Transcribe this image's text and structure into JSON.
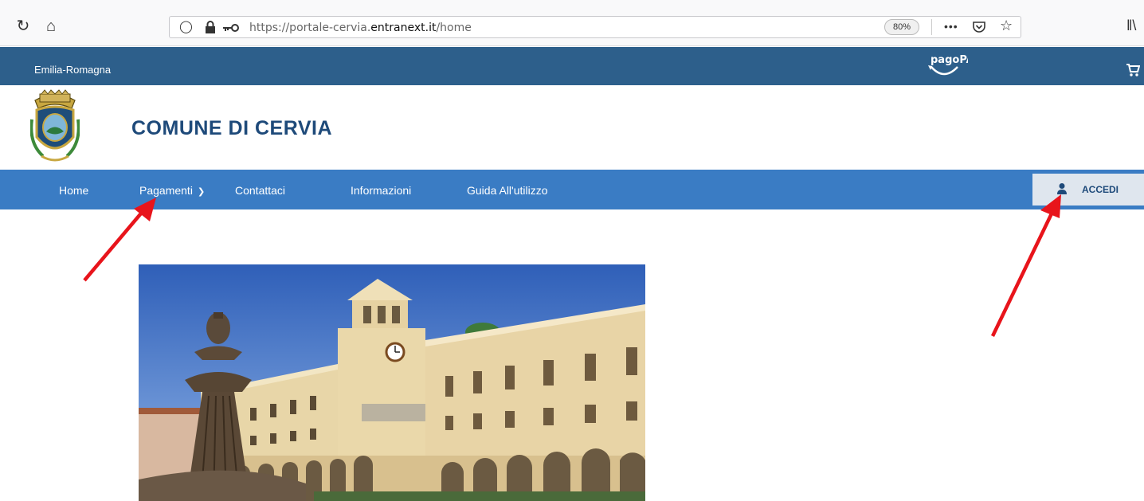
{
  "browser": {
    "url_prefix": "https://portale-cervia.",
    "url_domain": "entranext.it",
    "url_suffix": "/home",
    "zoom": "80%"
  },
  "region": {
    "label": "Emilia-Romagna"
  },
  "brand": {
    "pagopa_label": "pagoPA"
  },
  "header": {
    "title": "COMUNE DI CERVIA"
  },
  "nav": {
    "items": [
      {
        "label": "Home"
      },
      {
        "label": "Pagamenti"
      },
      {
        "label": "Contattaci"
      },
      {
        "label": "Informazioni"
      },
      {
        "label": "Guida All'utilizzo"
      }
    ],
    "login_label": "ACCEDI"
  },
  "colors": {
    "region_bar": "#2d5f8b",
    "nav_bar": "#3a7cc4",
    "title": "#1e4a7a",
    "annotation_arrow": "#e8141b"
  }
}
